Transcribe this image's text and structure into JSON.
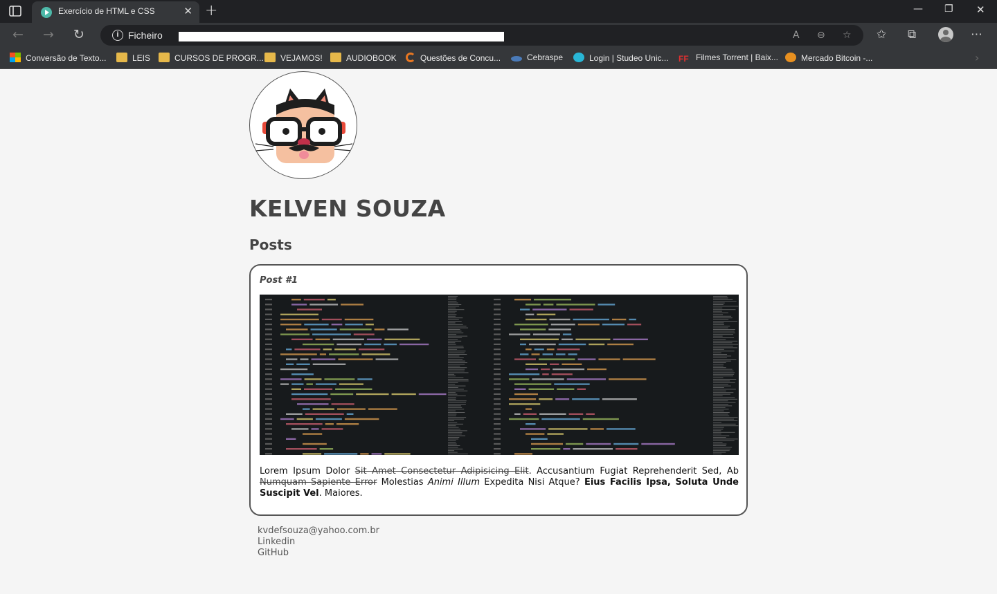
{
  "browser": {
    "tab_title": "Exercício de HTML e CSS",
    "address_scheme": "Ficheiro",
    "bookmarks": [
      {
        "label": "Conversão de Texto...",
        "icon": "microsoft-icon"
      },
      {
        "label": "LEIS",
        "icon": "folder-icon"
      },
      {
        "label": "CURSOS DE PROGR...",
        "icon": "folder-icon"
      },
      {
        "label": "VEJAMOS!",
        "icon": "folder-icon"
      },
      {
        "label": "AUDIOBOOK",
        "icon": "folder-icon"
      },
      {
        "label": "Questões de Concu...",
        "icon": "qconcursos-icon"
      },
      {
        "label": "Cebraspe",
        "icon": "cebraspe-icon"
      },
      {
        "label": "Login | Studeo Unic...",
        "icon": "studeo-icon"
      },
      {
        "label": "Filmes Torrent | Baix...",
        "icon": "ff-icon"
      },
      {
        "label": "Mercado Bitcoin -...",
        "icon": "bitcoin-icon"
      }
    ],
    "ff_icon_text": "FF"
  },
  "profile": {
    "name": "KELVEN SOUZA",
    "avatar_alt": "cat-avatar-illustration"
  },
  "posts": {
    "title": "Posts",
    "items": [
      {
        "label": "Post #1",
        "image": "code-screenshot",
        "text": {
          "t1": "Lorem Ipsum Dolor ",
          "t2_strike": "Sit Amet Consectetur Adipisicing Elit",
          "t3": ". Accusantium Fugiat Reprehenderit Sed, Ab ",
          "t4_strike": "Numquam Sapiente Error",
          "t5": " Molestias ",
          "t6_italic": "Animi Illum",
          "t7": " Expedita Nisi Atque? ",
          "t8_bold": "Eius Facilis Ipsa, Soluta Unde Suscipit Vel",
          "t9": ". Maiores."
        }
      }
    ]
  },
  "contacts": {
    "email": "kvdefsouza@yahoo.com.br",
    "linkedin": "Linkedin",
    "github": "GitHub"
  }
}
